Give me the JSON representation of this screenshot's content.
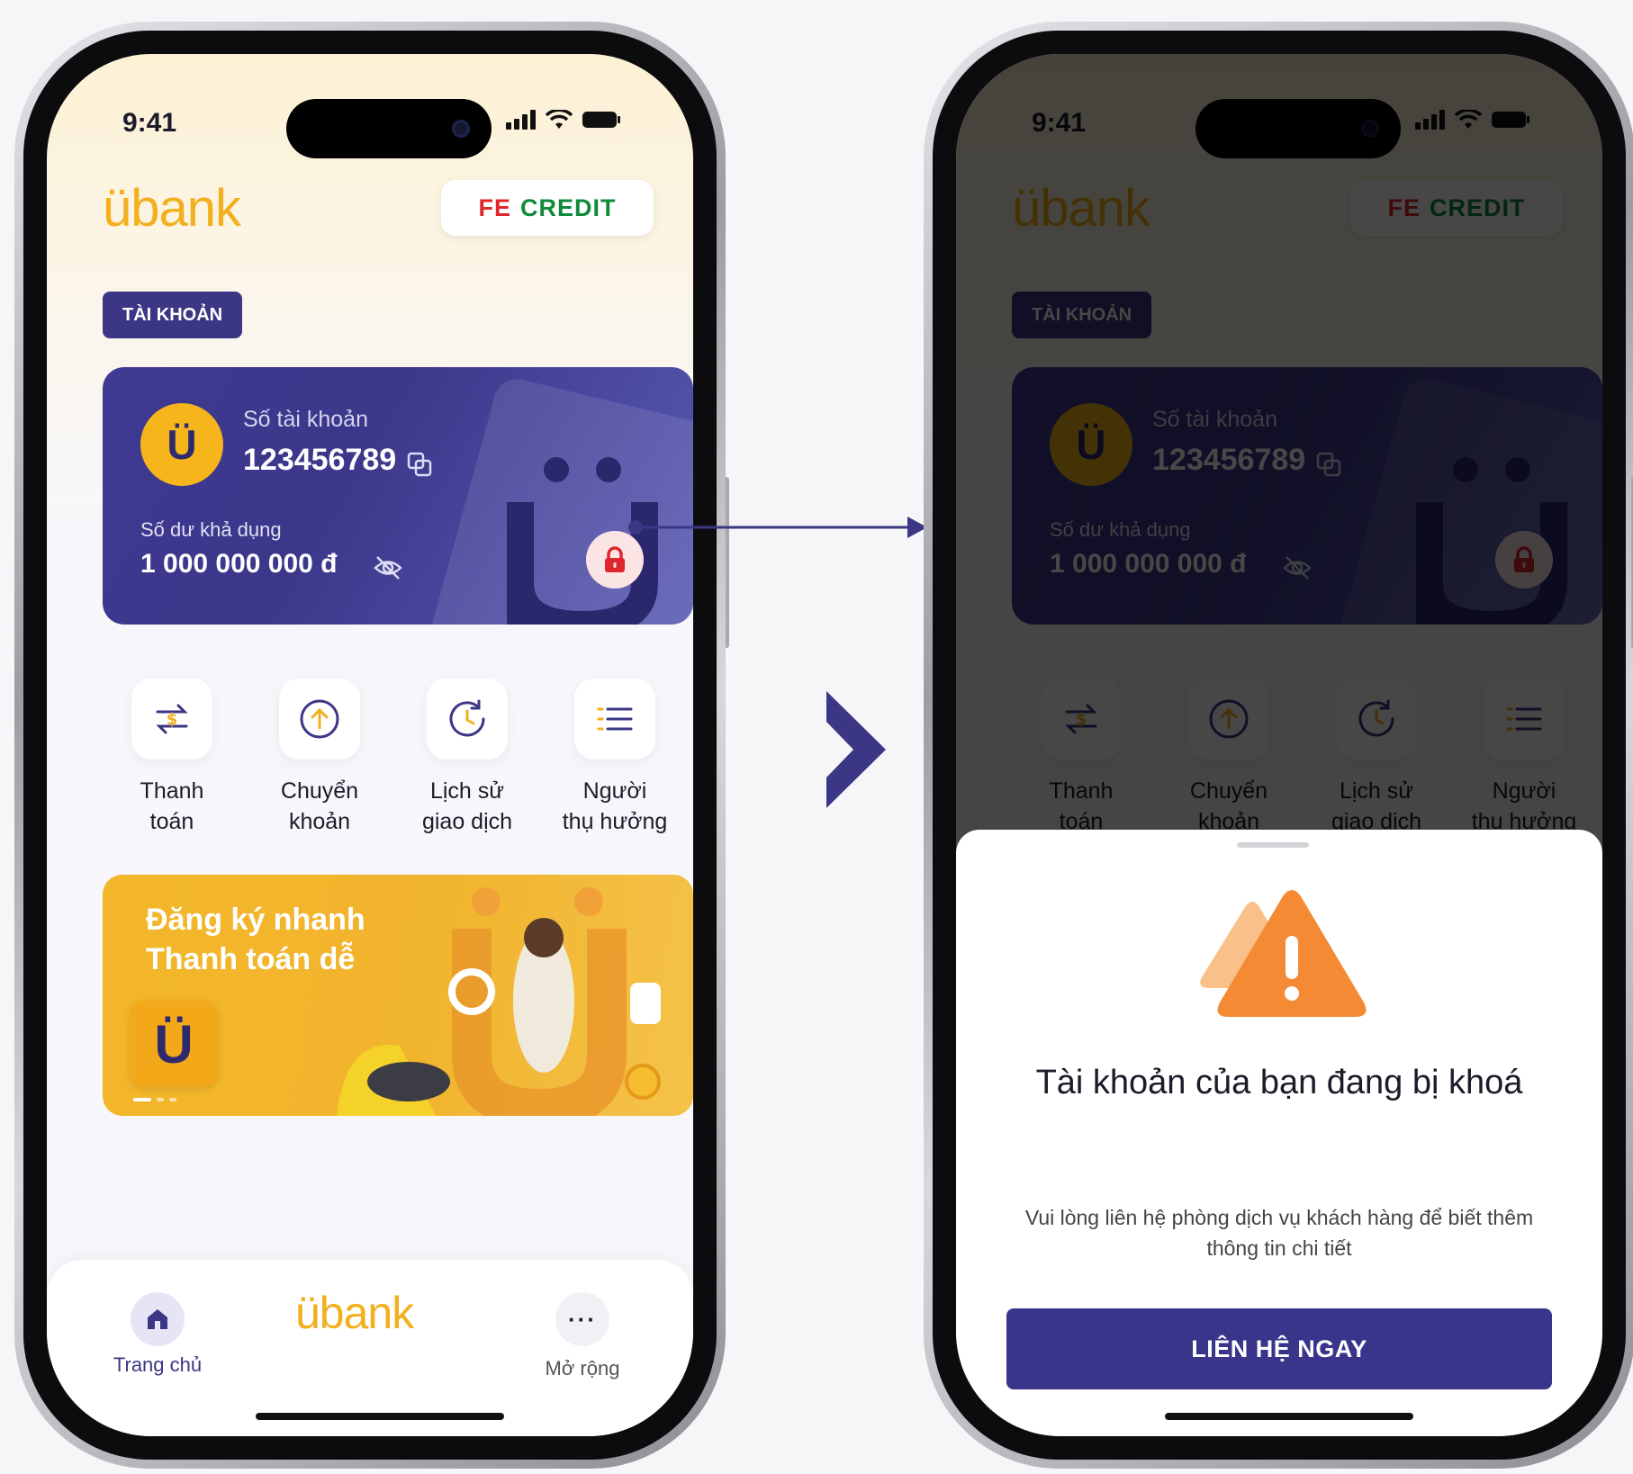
{
  "status": {
    "time": "9:41"
  },
  "header": {
    "brand": "übank",
    "partner_fe": "FE",
    "partner_credit": "CREDIT"
  },
  "account": {
    "tag": "TÀI KHOẢN",
    "avatar_letter": "Ü",
    "number_label": "Số tài khoản",
    "number": "123456789",
    "balance_label": "Số dư khả dụng",
    "balance": "1 000 000 000 đ"
  },
  "quick_actions": [
    {
      "label_1": "Thanh",
      "label_2": "toán",
      "icon": "payment-swap-icon"
    },
    {
      "label_1": "Chuyển",
      "label_2": "khoản",
      "icon": "transfer-up-icon"
    },
    {
      "label_1": "Lịch sử",
      "label_2": "giao dịch",
      "icon": "history-icon"
    },
    {
      "label_1": "Người",
      "label_2": "thụ hưởng",
      "icon": "list-icon"
    }
  ],
  "promo": {
    "line1": "Đăng ký nhanh",
    "line2": "Thanh toán dễ",
    "logo": "Ü"
  },
  "nav": {
    "home": "Trang chủ",
    "brand": "übank",
    "more": "Mở rộng",
    "more_glyph": "···"
  },
  "locked_sheet": {
    "title": "Tài khoản của bạn đang bị khoá",
    "description": "Vui lòng liên hệ phòng dịch vụ khách hàng để biết thêm thông tin chi tiết",
    "button": "LIÊN HỆ NGAY"
  },
  "colors": {
    "brand_yellow": "#f2b01e",
    "brand_indigo": "#3b3785",
    "lock_red": "#e0262d",
    "warning_orange": "#f58a34"
  }
}
